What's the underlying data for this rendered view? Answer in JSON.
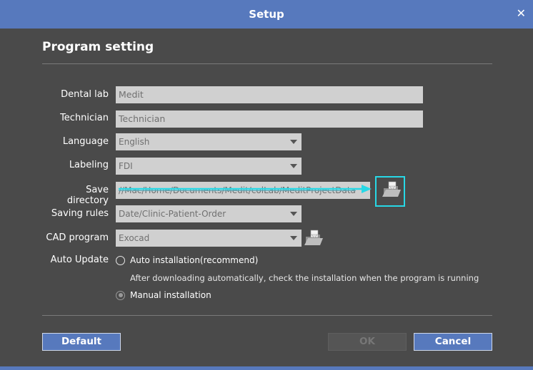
{
  "window": {
    "title": "Setup",
    "close_glyph": "✕"
  },
  "section": {
    "title": "Program setting"
  },
  "form": {
    "dental_lab": {
      "label": "Dental lab",
      "value": "Medit"
    },
    "technician": {
      "label": "Technician",
      "value": "Technician"
    },
    "language": {
      "label": "Language",
      "value": "English"
    },
    "labeling": {
      "label": "Labeling",
      "value": "FDI"
    },
    "save_directory": {
      "label": "Save directory",
      "value": "//Mac/Home/Documents/Medit/colLab/MeditProjectData",
      "icon": "folder-icon"
    },
    "saving_rules": {
      "label": "Saving rules",
      "value": "Date/Clinic-Patient-Order"
    },
    "cad_program": {
      "label": "CAD program",
      "value": "Exocad",
      "icon": "folder-icon"
    },
    "auto_update": {
      "label": "Auto Update",
      "options": [
        {
          "label": "Auto installation(recommend)",
          "selected": false
        },
        {
          "label": "Manual installation",
          "selected": true
        }
      ],
      "note": "After downloading automatically, check the installation when the program is running"
    }
  },
  "buttons": {
    "default": "Default",
    "ok": "OK",
    "cancel": "Cancel"
  },
  "colors": {
    "titlebar": "#5779bd",
    "background": "#4a4a4a",
    "highlight": "#27d8e6"
  }
}
